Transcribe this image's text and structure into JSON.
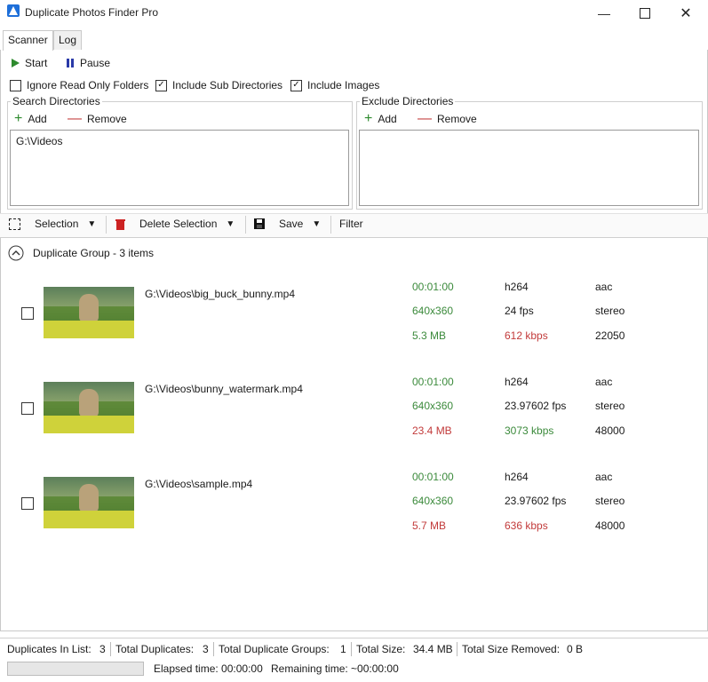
{
  "window": {
    "title": "Duplicate Photos Finder Pro"
  },
  "tabs": [
    {
      "label": "Scanner"
    },
    {
      "label": "Log"
    }
  ],
  "toolbar": {
    "start_label": "Start",
    "pause_label": "Pause"
  },
  "options": {
    "ignore_readonly": {
      "label": "Ignore Read Only Folders",
      "checked": false
    },
    "include_subdirs": {
      "label": "Include Sub Directories",
      "checked": true
    },
    "include_images": {
      "label": "Include Images",
      "checked": true
    }
  },
  "search_dirs": {
    "title": "Search Directories",
    "add_label": "Add",
    "remove_label": "Remove",
    "items": [
      "G:\\Videos"
    ]
  },
  "exclude_dirs": {
    "title": "Exclude Directories",
    "add_label": "Add",
    "remove_label": "Remove",
    "items": []
  },
  "actions": {
    "selection_label": "Selection",
    "delete_label": "Delete Selection",
    "save_label": "Save",
    "filter_label": "Filter"
  },
  "group": {
    "title": "Duplicate Group - 3 items",
    "items": [
      {
        "path": "G:\\Videos\\big_buck_bunny.mp4",
        "duration": "00:01:00",
        "video_codec": "h264",
        "audio_codec": "aac",
        "resolution": "640x360",
        "fps": "24 fps",
        "channels": "stereo",
        "size": "5.3 MB",
        "bitrate": "612 kbps",
        "sample_rate": "22050",
        "size_status": "good",
        "bitrate_status": "bad"
      },
      {
        "path": "G:\\Videos\\bunny_watermark.mp4",
        "duration": "00:01:00",
        "video_codec": "h264",
        "audio_codec": "aac",
        "resolution": "640x360",
        "fps": "23.97602 fps",
        "channels": "stereo",
        "size": "23.4 MB",
        "bitrate": "3073 kbps",
        "sample_rate": "48000",
        "size_status": "bad",
        "bitrate_status": "good"
      },
      {
        "path": "G:\\Videos\\sample.mp4",
        "duration": "00:01:00",
        "video_codec": "h264",
        "audio_codec": "aac",
        "resolution": "640x360",
        "fps": "23.97602 fps",
        "channels": "stereo",
        "size": "5.7 MB",
        "bitrate": "636 kbps",
        "sample_rate": "48000",
        "size_status": "bad",
        "bitrate_status": "bad"
      }
    ]
  },
  "status": {
    "dup_in_list": "Duplicates In List:",
    "dup_in_list_val": "3",
    "total_dup": "Total Duplicates:",
    "total_dup_val": "3",
    "total_groups": "Total Duplicate Groups:",
    "total_groups_val": "1",
    "total_size": "Total Size:",
    "total_size_val": "34.4 MB",
    "removed": "Total Size Removed:",
    "removed_val": "0 B",
    "elapsed": "Elapsed time: 00:00:00",
    "remaining": "Remaining time: ~00:00:00",
    "progress": 0
  },
  "colors": {
    "good": "#3b8a3b",
    "bad": "#c23a3a",
    "accent": "#1e6fd9"
  }
}
